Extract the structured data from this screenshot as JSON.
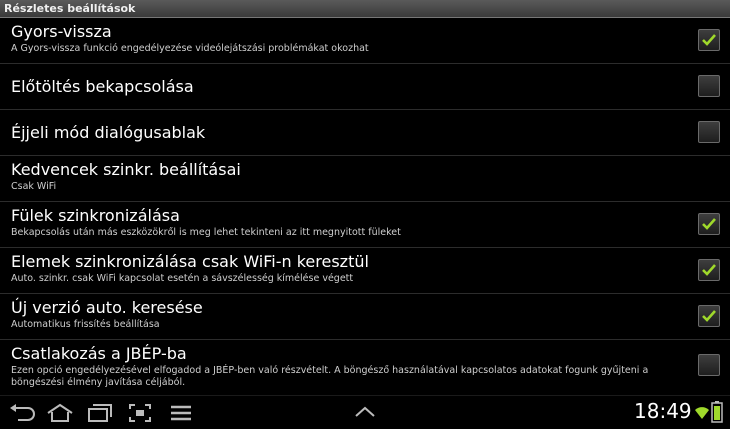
{
  "header": {
    "title": "Részletes beállítások"
  },
  "settings": [
    {
      "title": "Gyors-vissza",
      "summary": "A Gyors-vissza funkció engedélyezése videólejátszási problémákat okozhat",
      "checked": true
    },
    {
      "title": "Előtöltés bekapcsolása",
      "summary": "",
      "checked": false
    },
    {
      "title": "Éjjeli mód dialógusablak",
      "summary": "",
      "checked": false
    },
    {
      "title": "Kedvencek szinkr. beállításai",
      "summary": "Csak WiFi",
      "checked": null
    },
    {
      "title": "Fülek szinkronizálása",
      "summary": "Bekapcsolás után más eszközökről is meg lehet tekinteni az itt megnyitott füleket",
      "checked": true
    },
    {
      "title": "Elemek szinkronizálása csak WiFi-n keresztül",
      "summary": "Auto. szinkr. csak WiFi kapcsolat esetén a sávszélesség kímélése végett",
      "checked": true
    },
    {
      "title": "Új verzió auto. keresése",
      "summary": "Automatikus frissítés beállítása",
      "checked": true
    },
    {
      "title": "Csatlakozás a JBÉP-ba",
      "summary": "Ezen opció engedélyezésével elfogadod a JBÉP-ben való részvételt. A böngésző használatával kapcsolatos adatokat fogunk gyűjteni a böngészési élmény javítása céljából.",
      "checked": false
    }
  ],
  "status_bar": {
    "time": "18:49"
  },
  "colors": {
    "check_mark": "#9fd92b",
    "title_bar": "#4a4a4a"
  },
  "icons": [
    "back-icon",
    "home-icon",
    "recent-apps-icon",
    "screenshot-icon",
    "menu-icon",
    "chevron-up-icon",
    "wifi-icon",
    "battery-icon"
  ]
}
